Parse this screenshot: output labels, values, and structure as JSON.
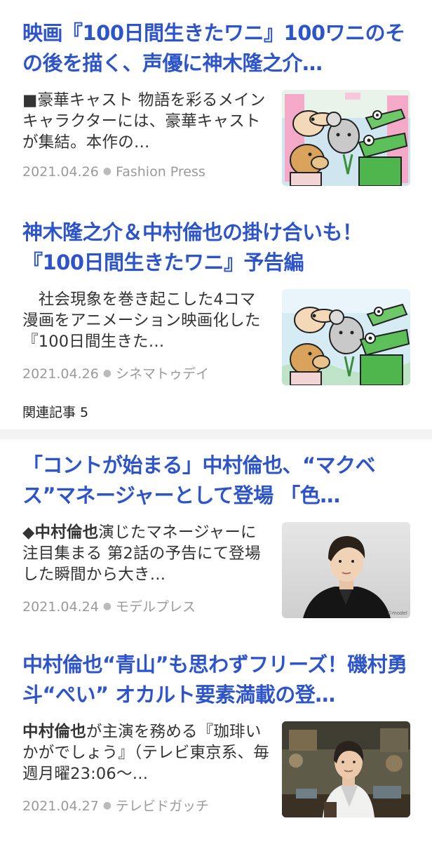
{
  "articles": [
    {
      "headline": "映画『100日間生きたワニ』100ワニのその後を描く、声優に神木隆之介…",
      "snippet_bold": "",
      "snippet": "■豪華キャスト 物語を彩るメインキャラクターには、豪華キャストが集結。本作の…",
      "date": "2021.04.26",
      "source": "Fashion Press",
      "thumb_icon": "anime-characters-thumbnail"
    },
    {
      "headline": "神木隆之介＆中村倫也の掛け合いも！『100日間生きたワニ』予告編",
      "snippet_bold": "",
      "snippet": "　社会現象を巻き起こした4コマ漫画をアニメーション映画化した『100日間生きた…",
      "date": "2021.04.26",
      "source": "シネマトゥデイ",
      "thumb_icon": "anime-characters-thumbnail"
    },
    {
      "headline": "「コントが始まる」中村倫也、“マクベス”マネージャーとして登場 「色…",
      "snippet_bold": "◆中村倫也",
      "snippet": "演じたマネージャーに注目集まる 第2話の予告にて登場した瞬間から大き…",
      "date": "2021.04.24",
      "source": "モデルプレス",
      "thumb_icon": "actor-portrait-thumbnail"
    },
    {
      "headline": "中村倫也“青山”も思わずフリーズ！磯村勇斗“ぺい” オカルト要素満載の登…",
      "snippet_bold": "中村倫也",
      "snippet": "が主演を務める『珈琲いかがでしょう』（テレビ東京系、毎週月曜23:06〜…",
      "date": "2021.04.27",
      "source": "テレビドガッチ",
      "thumb_icon": "cafe-scene-thumbnail"
    }
  ],
  "related_label": "関連記事 5",
  "colors": {
    "headline": "#2d55c9",
    "meta": "#9a9a9a",
    "separator": "#f3f3f3"
  }
}
